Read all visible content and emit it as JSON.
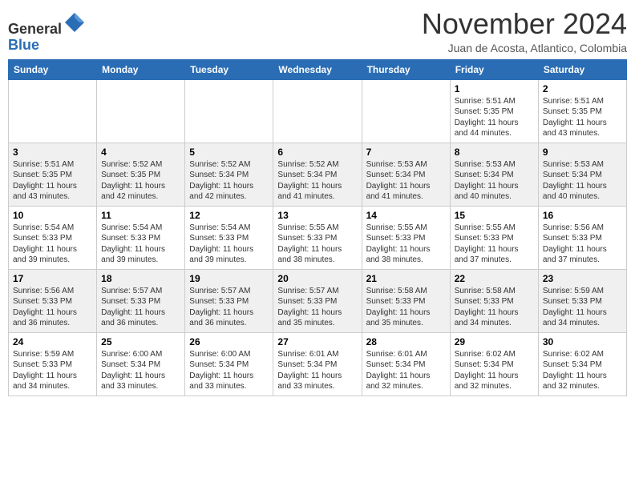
{
  "header": {
    "logo_line1": "General",
    "logo_line2": "Blue",
    "month": "November 2024",
    "location": "Juan de Acosta, Atlantico, Colombia"
  },
  "weekdays": [
    "Sunday",
    "Monday",
    "Tuesday",
    "Wednesday",
    "Thursday",
    "Friday",
    "Saturday"
  ],
  "weeks": [
    [
      {
        "day": "",
        "info": ""
      },
      {
        "day": "",
        "info": ""
      },
      {
        "day": "",
        "info": ""
      },
      {
        "day": "",
        "info": ""
      },
      {
        "day": "",
        "info": ""
      },
      {
        "day": "1",
        "info": "Sunrise: 5:51 AM\nSunset: 5:35 PM\nDaylight: 11 hours\nand 44 minutes."
      },
      {
        "day": "2",
        "info": "Sunrise: 5:51 AM\nSunset: 5:35 PM\nDaylight: 11 hours\nand 43 minutes."
      }
    ],
    [
      {
        "day": "3",
        "info": "Sunrise: 5:51 AM\nSunset: 5:35 PM\nDaylight: 11 hours\nand 43 minutes."
      },
      {
        "day": "4",
        "info": "Sunrise: 5:52 AM\nSunset: 5:35 PM\nDaylight: 11 hours\nand 42 minutes."
      },
      {
        "day": "5",
        "info": "Sunrise: 5:52 AM\nSunset: 5:34 PM\nDaylight: 11 hours\nand 42 minutes."
      },
      {
        "day": "6",
        "info": "Sunrise: 5:52 AM\nSunset: 5:34 PM\nDaylight: 11 hours\nand 41 minutes."
      },
      {
        "day": "7",
        "info": "Sunrise: 5:53 AM\nSunset: 5:34 PM\nDaylight: 11 hours\nand 41 minutes."
      },
      {
        "day": "8",
        "info": "Sunrise: 5:53 AM\nSunset: 5:34 PM\nDaylight: 11 hours\nand 40 minutes."
      },
      {
        "day": "9",
        "info": "Sunrise: 5:53 AM\nSunset: 5:34 PM\nDaylight: 11 hours\nand 40 minutes."
      }
    ],
    [
      {
        "day": "10",
        "info": "Sunrise: 5:54 AM\nSunset: 5:33 PM\nDaylight: 11 hours\nand 39 minutes."
      },
      {
        "day": "11",
        "info": "Sunrise: 5:54 AM\nSunset: 5:33 PM\nDaylight: 11 hours\nand 39 minutes."
      },
      {
        "day": "12",
        "info": "Sunrise: 5:54 AM\nSunset: 5:33 PM\nDaylight: 11 hours\nand 39 minutes."
      },
      {
        "day": "13",
        "info": "Sunrise: 5:55 AM\nSunset: 5:33 PM\nDaylight: 11 hours\nand 38 minutes."
      },
      {
        "day": "14",
        "info": "Sunrise: 5:55 AM\nSunset: 5:33 PM\nDaylight: 11 hours\nand 38 minutes."
      },
      {
        "day": "15",
        "info": "Sunrise: 5:55 AM\nSunset: 5:33 PM\nDaylight: 11 hours\nand 37 minutes."
      },
      {
        "day": "16",
        "info": "Sunrise: 5:56 AM\nSunset: 5:33 PM\nDaylight: 11 hours\nand 37 minutes."
      }
    ],
    [
      {
        "day": "17",
        "info": "Sunrise: 5:56 AM\nSunset: 5:33 PM\nDaylight: 11 hours\nand 36 minutes."
      },
      {
        "day": "18",
        "info": "Sunrise: 5:57 AM\nSunset: 5:33 PM\nDaylight: 11 hours\nand 36 minutes."
      },
      {
        "day": "19",
        "info": "Sunrise: 5:57 AM\nSunset: 5:33 PM\nDaylight: 11 hours\nand 36 minutes."
      },
      {
        "day": "20",
        "info": "Sunrise: 5:57 AM\nSunset: 5:33 PM\nDaylight: 11 hours\nand 35 minutes."
      },
      {
        "day": "21",
        "info": "Sunrise: 5:58 AM\nSunset: 5:33 PM\nDaylight: 11 hours\nand 35 minutes."
      },
      {
        "day": "22",
        "info": "Sunrise: 5:58 AM\nSunset: 5:33 PM\nDaylight: 11 hours\nand 34 minutes."
      },
      {
        "day": "23",
        "info": "Sunrise: 5:59 AM\nSunset: 5:33 PM\nDaylight: 11 hours\nand 34 minutes."
      }
    ],
    [
      {
        "day": "24",
        "info": "Sunrise: 5:59 AM\nSunset: 5:33 PM\nDaylight: 11 hours\nand 34 minutes."
      },
      {
        "day": "25",
        "info": "Sunrise: 6:00 AM\nSunset: 5:34 PM\nDaylight: 11 hours\nand 33 minutes."
      },
      {
        "day": "26",
        "info": "Sunrise: 6:00 AM\nSunset: 5:34 PM\nDaylight: 11 hours\nand 33 minutes."
      },
      {
        "day": "27",
        "info": "Sunrise: 6:01 AM\nSunset: 5:34 PM\nDaylight: 11 hours\nand 33 minutes."
      },
      {
        "day": "28",
        "info": "Sunrise: 6:01 AM\nSunset: 5:34 PM\nDaylight: 11 hours\nand 32 minutes."
      },
      {
        "day": "29",
        "info": "Sunrise: 6:02 AM\nSunset: 5:34 PM\nDaylight: 11 hours\nand 32 minutes."
      },
      {
        "day": "30",
        "info": "Sunrise: 6:02 AM\nSunset: 5:34 PM\nDaylight: 11 hours\nand 32 minutes."
      }
    ]
  ]
}
